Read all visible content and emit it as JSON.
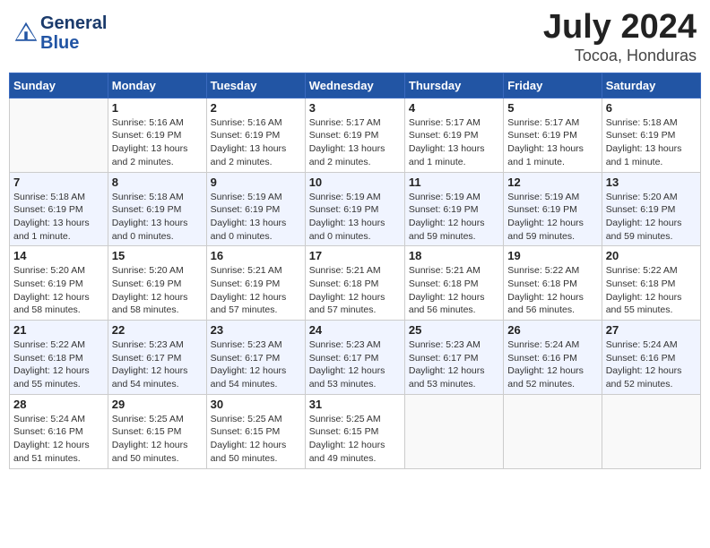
{
  "header": {
    "logo_text_general": "General",
    "logo_text_blue": "Blue",
    "month_year": "July 2024",
    "location": "Tocoa, Honduras"
  },
  "weekdays": [
    "Sunday",
    "Monday",
    "Tuesday",
    "Wednesday",
    "Thursday",
    "Friday",
    "Saturday"
  ],
  "weeks": [
    [
      {
        "day": "",
        "info": ""
      },
      {
        "day": "1",
        "info": "Sunrise: 5:16 AM\nSunset: 6:19 PM\nDaylight: 13 hours\nand 2 minutes."
      },
      {
        "day": "2",
        "info": "Sunrise: 5:16 AM\nSunset: 6:19 PM\nDaylight: 13 hours\nand 2 minutes."
      },
      {
        "day": "3",
        "info": "Sunrise: 5:17 AM\nSunset: 6:19 PM\nDaylight: 13 hours\nand 2 minutes."
      },
      {
        "day": "4",
        "info": "Sunrise: 5:17 AM\nSunset: 6:19 PM\nDaylight: 13 hours\nand 1 minute."
      },
      {
        "day": "5",
        "info": "Sunrise: 5:17 AM\nSunset: 6:19 PM\nDaylight: 13 hours\nand 1 minute."
      },
      {
        "day": "6",
        "info": "Sunrise: 5:18 AM\nSunset: 6:19 PM\nDaylight: 13 hours\nand 1 minute."
      }
    ],
    [
      {
        "day": "7",
        "info": "Sunrise: 5:18 AM\nSunset: 6:19 PM\nDaylight: 13 hours\nand 1 minute."
      },
      {
        "day": "8",
        "info": "Sunrise: 5:18 AM\nSunset: 6:19 PM\nDaylight: 13 hours\nand 0 minutes."
      },
      {
        "day": "9",
        "info": "Sunrise: 5:19 AM\nSunset: 6:19 PM\nDaylight: 13 hours\nand 0 minutes."
      },
      {
        "day": "10",
        "info": "Sunrise: 5:19 AM\nSunset: 6:19 PM\nDaylight: 13 hours\nand 0 minutes."
      },
      {
        "day": "11",
        "info": "Sunrise: 5:19 AM\nSunset: 6:19 PM\nDaylight: 12 hours\nand 59 minutes."
      },
      {
        "day": "12",
        "info": "Sunrise: 5:19 AM\nSunset: 6:19 PM\nDaylight: 12 hours\nand 59 minutes."
      },
      {
        "day": "13",
        "info": "Sunrise: 5:20 AM\nSunset: 6:19 PM\nDaylight: 12 hours\nand 59 minutes."
      }
    ],
    [
      {
        "day": "14",
        "info": "Sunrise: 5:20 AM\nSunset: 6:19 PM\nDaylight: 12 hours\nand 58 minutes."
      },
      {
        "day": "15",
        "info": "Sunrise: 5:20 AM\nSunset: 6:19 PM\nDaylight: 12 hours\nand 58 minutes."
      },
      {
        "day": "16",
        "info": "Sunrise: 5:21 AM\nSunset: 6:19 PM\nDaylight: 12 hours\nand 57 minutes."
      },
      {
        "day": "17",
        "info": "Sunrise: 5:21 AM\nSunset: 6:18 PM\nDaylight: 12 hours\nand 57 minutes."
      },
      {
        "day": "18",
        "info": "Sunrise: 5:21 AM\nSunset: 6:18 PM\nDaylight: 12 hours\nand 56 minutes."
      },
      {
        "day": "19",
        "info": "Sunrise: 5:22 AM\nSunset: 6:18 PM\nDaylight: 12 hours\nand 56 minutes."
      },
      {
        "day": "20",
        "info": "Sunrise: 5:22 AM\nSunset: 6:18 PM\nDaylight: 12 hours\nand 55 minutes."
      }
    ],
    [
      {
        "day": "21",
        "info": "Sunrise: 5:22 AM\nSunset: 6:18 PM\nDaylight: 12 hours\nand 55 minutes."
      },
      {
        "day": "22",
        "info": "Sunrise: 5:23 AM\nSunset: 6:17 PM\nDaylight: 12 hours\nand 54 minutes."
      },
      {
        "day": "23",
        "info": "Sunrise: 5:23 AM\nSunset: 6:17 PM\nDaylight: 12 hours\nand 54 minutes."
      },
      {
        "day": "24",
        "info": "Sunrise: 5:23 AM\nSunset: 6:17 PM\nDaylight: 12 hours\nand 53 minutes."
      },
      {
        "day": "25",
        "info": "Sunrise: 5:23 AM\nSunset: 6:17 PM\nDaylight: 12 hours\nand 53 minutes."
      },
      {
        "day": "26",
        "info": "Sunrise: 5:24 AM\nSunset: 6:16 PM\nDaylight: 12 hours\nand 52 minutes."
      },
      {
        "day": "27",
        "info": "Sunrise: 5:24 AM\nSunset: 6:16 PM\nDaylight: 12 hours\nand 52 minutes."
      }
    ],
    [
      {
        "day": "28",
        "info": "Sunrise: 5:24 AM\nSunset: 6:16 PM\nDaylight: 12 hours\nand 51 minutes."
      },
      {
        "day": "29",
        "info": "Sunrise: 5:25 AM\nSunset: 6:15 PM\nDaylight: 12 hours\nand 50 minutes."
      },
      {
        "day": "30",
        "info": "Sunrise: 5:25 AM\nSunset: 6:15 PM\nDaylight: 12 hours\nand 50 minutes."
      },
      {
        "day": "31",
        "info": "Sunrise: 5:25 AM\nSunset: 6:15 PM\nDaylight: 12 hours\nand 49 minutes."
      },
      {
        "day": "",
        "info": ""
      },
      {
        "day": "",
        "info": ""
      },
      {
        "day": "",
        "info": ""
      }
    ]
  ]
}
